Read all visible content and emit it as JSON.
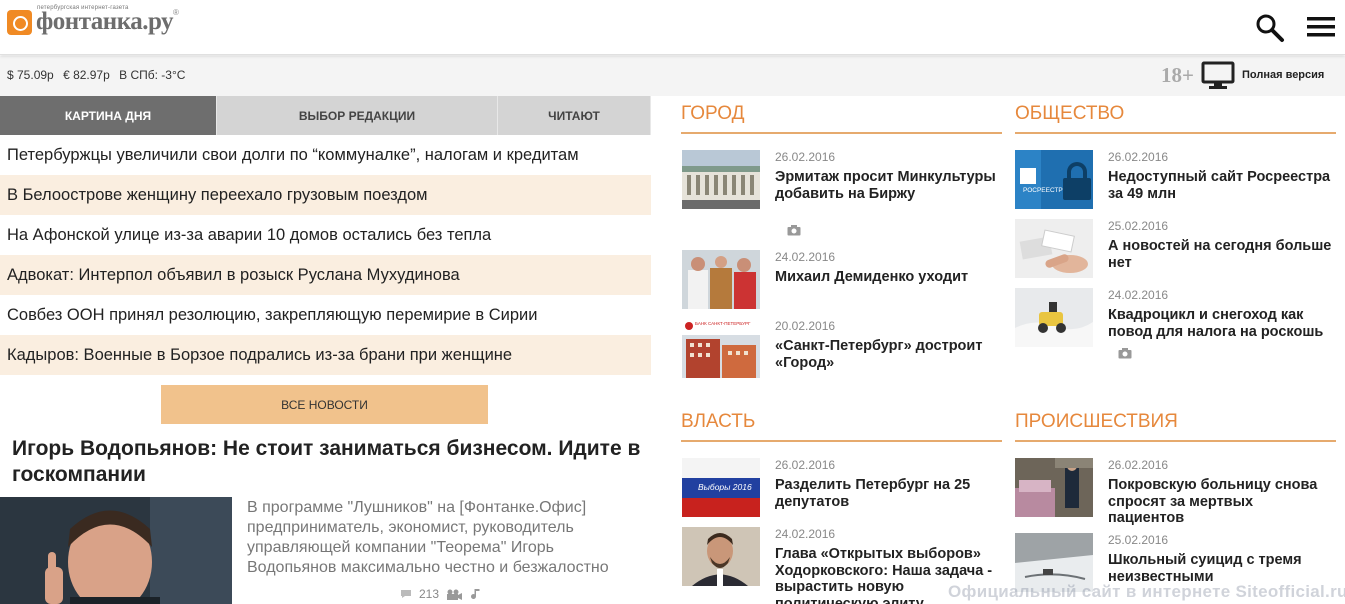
{
  "header": {
    "logo_tag": "петербургская интернет-газета",
    "logo_text": "фонтанка.ру",
    "logo_reg": "®"
  },
  "infobar": {
    "usd": "$ 75.09р",
    "eur": "€ 82.97р",
    "weather": "В СПб: -3°С",
    "age": "18+",
    "full_version": "Полная версия"
  },
  "tabs": [
    {
      "label": "КАРТИНА ДНЯ",
      "active": true
    },
    {
      "label": "ВЫБОР РЕДАКЦИИ",
      "active": false
    },
    {
      "label": "ЧИТАЮТ",
      "active": false
    }
  ],
  "news": [
    "Петербуржцы увеличили свои долги по “коммуналке”, налогам и кредитам",
    "В Белоострове женщину переехало грузовым поездом",
    "На Афонской улице из-за аварии 10 домов остались без тепла",
    "Адвокат: Интерпол объявил в розыск Руслана Мухудинова",
    "Совбез ООН принял резолюцию, закрепляющую перемирие в Сирии",
    "Кадыров: Военные в Борзое подрались из-за брани при женщине"
  ],
  "all_news": "ВСЕ НОВОСТИ",
  "feature": {
    "title": "Игорь Водопьянов: Не стоит заниматься бизнесом. Идите в госкомпании",
    "text": "В программе \"Лушников\" на [Фонтанке.Офис] предприниматель, экономист, руководитель управляющей компании \"Теорема\" Игорь Водопьянов максимально честно и безжалостно",
    "comments": "213"
  },
  "sections": {
    "gorod": {
      "title": "ГОРОД",
      "articles": [
        {
          "date": "26.02.2016",
          "title": "Эрмитаж просит Минкультуры добавить на Биржу"
        },
        {
          "date": "24.02.2016",
          "title": "Михаил Демиденко уходит"
        },
        {
          "date": "20.02.2016",
          "title": "«Санкт-Петербург» достроит «Город»"
        }
      ]
    },
    "obshchestvo": {
      "title": "ОБЩЕСТВО",
      "articles": [
        {
          "date": "26.02.2016",
          "title": "Недоступный сайт Росреестра за 49 млн"
        },
        {
          "date": "25.02.2016",
          "title": "А новостей на сегодня больше нет"
        },
        {
          "date": "24.02.2016",
          "title": "Квадроцикл и снегоход как повод для налога на роскошь"
        }
      ]
    },
    "vlast": {
      "title": "ВЛАСТЬ",
      "articles": [
        {
          "date": "26.02.2016",
          "title": "Разделить Петербург на 25 депутатов"
        },
        {
          "date": "24.02.2016",
          "title": "Глава «Открытых выборов» Ходорковского: Наша задача - вырастить новую политическую элиту"
        }
      ]
    },
    "proisshestviya": {
      "title": "ПРОИСШЕСТВИЯ",
      "articles": [
        {
          "date": "26.02.2016",
          "title": "Покровскую больницу снова спросят за мертвых пациентов"
        },
        {
          "date": "25.02.2016",
          "title": "Школьный суицид с тремя неизвестными"
        }
      ]
    }
  },
  "image_texts": {
    "rosreestr": "РОСРЕЕСТР",
    "bank": "БАНК САНКТ-ПЕТЕРБУРГ",
    "vybory": "Выборы 2016"
  },
  "watermark": "Официальный сайт в интернете Siteofficial.ru",
  "colors": {
    "accent": "#e6883c",
    "tab_active": "#6e6e6e",
    "highlight_row": "#faeee0",
    "button": "#f1c28c"
  }
}
